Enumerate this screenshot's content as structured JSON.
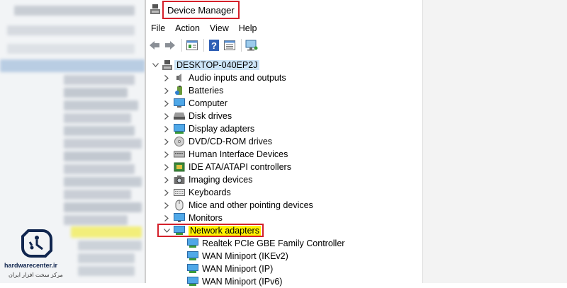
{
  "window": {
    "title": "Device Manager"
  },
  "menu": [
    "File",
    "Action",
    "View",
    "Help"
  ],
  "toolbar": [
    {
      "icon": "back-arrow-icon"
    },
    {
      "icon": "forward-arrow-icon"
    },
    {
      "icon": "properties-view-icon"
    },
    {
      "icon": "help-icon"
    },
    {
      "icon": "device-view-icon"
    },
    {
      "icon": "monitor-scan-icon"
    }
  ],
  "tree": {
    "root": "DESKTOP-040EP2J",
    "categories": [
      {
        "label": "Audio inputs and outputs",
        "icon": "speaker-icon",
        "expanded": false
      },
      {
        "label": "Batteries",
        "icon": "battery-icon",
        "expanded": false
      },
      {
        "label": "Computer",
        "icon": "computer-icon",
        "expanded": false
      },
      {
        "label": "Disk drives",
        "icon": "disk-drive-icon",
        "expanded": false
      },
      {
        "label": "Display adapters",
        "icon": "display-adapter-icon",
        "expanded": false
      },
      {
        "label": "DVD/CD-ROM drives",
        "icon": "dvd-drive-icon",
        "expanded": false
      },
      {
        "label": "Human Interface Devices",
        "icon": "hid-icon",
        "expanded": false
      },
      {
        "label": "IDE ATA/ATAPI controllers",
        "icon": "ide-controller-icon",
        "expanded": false
      },
      {
        "label": "Imaging devices",
        "icon": "camera-icon",
        "expanded": false
      },
      {
        "label": "Keyboards",
        "icon": "keyboard-icon",
        "expanded": false
      },
      {
        "label": "Mice and other pointing devices",
        "icon": "mouse-icon",
        "expanded": false
      },
      {
        "label": "Monitors",
        "icon": "monitor-icon",
        "expanded": false
      },
      {
        "label": "Network adapters",
        "icon": "network-adapter-icon",
        "expanded": true
      }
    ],
    "network_children": [
      "Realtek PCIe GBE Family Controller",
      "WAN Miniport (IKEv2)",
      "WAN Miniport (IP)",
      "WAN Miniport (IPv6)"
    ]
  },
  "logo": {
    "brand": "hardwarecenter.ir",
    "subtitle": "مرکز سخت افزار ایران"
  },
  "colors": {
    "highlight_box": "#d4202a",
    "highlight_fill": "#fff200",
    "root_selection": "#cce4f7"
  }
}
